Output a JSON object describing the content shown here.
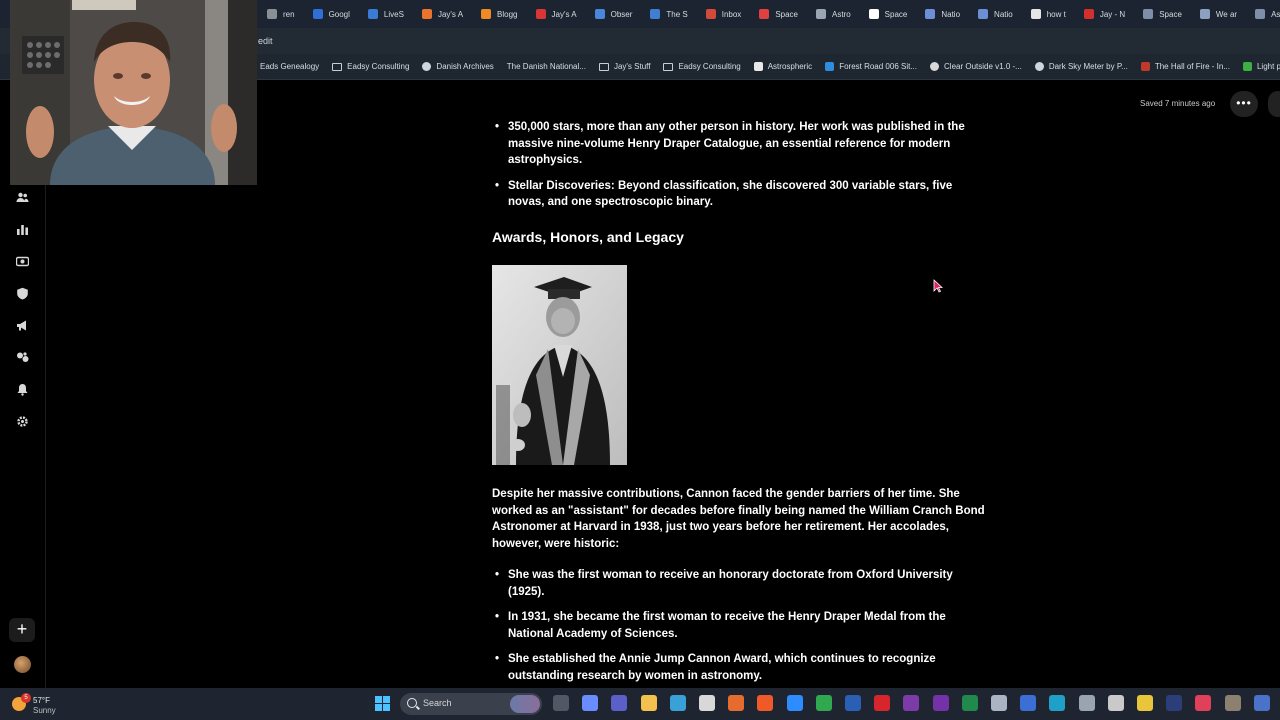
{
  "browser": {
    "tabs": [
      {
        "label": "ren",
        "color": "#8a8f96"
      },
      {
        "label": "Googl",
        "color": "#2f6fd6"
      },
      {
        "label": "LiveS",
        "color": "#3a7bd5"
      },
      {
        "label": "Jay's A",
        "color": "#e8742e"
      },
      {
        "label": "Blogg",
        "color": "#f08a24"
      },
      {
        "label": "Jay's A",
        "color": "#d93535"
      },
      {
        "label": "Obser",
        "color": "#4a86d9"
      },
      {
        "label": "The S",
        "color": "#3f7fd3"
      },
      {
        "label": "Inbox",
        "color": "#d34a3b"
      },
      {
        "label": "Space",
        "color": "#e04040"
      },
      {
        "label": "Astro",
        "color": "#9aa5b4"
      },
      {
        "label": "Space",
        "color": "#ffffff"
      },
      {
        "label": "Natio",
        "color": "#6d8fd6"
      },
      {
        "label": "Natio",
        "color": "#6d8fd6"
      },
      {
        "label": "how t",
        "color": "#e6e6e6"
      },
      {
        "label": "Jay - N",
        "color": "#d32f2f"
      },
      {
        "label": "Space",
        "color": "#7f8fa8"
      },
      {
        "label": "We ar",
        "color": "#8da0c0"
      },
      {
        "label": "Astro",
        "color": "#7f8fa8"
      }
    ],
    "toolbar_text": "edit",
    "bookmarks": [
      {
        "label": "Eads Genealogy",
        "type": "none"
      },
      {
        "label": "Eadsy Consulting",
        "type": "folder"
      },
      {
        "label": "Danish Archives",
        "type": "globe"
      },
      {
        "label": "The Danish National...",
        "type": "none"
      },
      {
        "label": "Jay's Stuff",
        "type": "folder"
      },
      {
        "label": "Eadsy Consulting",
        "type": "folder"
      },
      {
        "label": "Astrospheric",
        "type": "star"
      },
      {
        "label": "Forest Road 006 Sit...",
        "type": "blue"
      },
      {
        "label": "Clear Outside v1.0 -...",
        "type": "moon"
      },
      {
        "label": "Dark Sky Meter by P...",
        "type": "globe"
      },
      {
        "label": "The Hall of Fire - In...",
        "type": "book"
      },
      {
        "label": "Light pol",
        "type": "green"
      }
    ]
  },
  "editor": {
    "saved_status": "Saved 7 minutes ago",
    "more_label": "•••",
    "new_label": "+"
  },
  "document": {
    "cut_bullets": [
      {
        "text": "350,000 stars, more than any other person in history. Her work was published in the massive nine-volume Henry Draper Catalogue, an essential reference for modern astrophysics."
      },
      {
        "text": "Stellar Discoveries: Beyond classification, she discovered 300 variable stars, five novas, and one spectroscopic binary."
      }
    ],
    "heading": "Awards, Honors, and Legacy",
    "paragraph": "Despite her massive contributions, Cannon faced the gender barriers of her time. She worked as an \"assistant\" for decades before finally being named the William Cranch Bond Astronomer at Harvard in 1938, just two years before her retirement. Her accolades, however, were historic:",
    "honors": [
      "She was the first woman to receive an honorary doctorate from Oxford University (1925).",
      "In 1931, she became the first woman to receive the Henry Draper Medal from the National Academy of Sciences.",
      "She established the Annie Jump Cannon Award, which continues to recognize outstanding research by women in astronomy."
    ]
  },
  "taskbar": {
    "weather_temp": "57°F",
    "weather_condition": "Sunny",
    "weather_badge": "5",
    "search_label": "Search",
    "apps": [
      {
        "name": "file-manager",
        "color": "#505866"
      },
      {
        "name": "copilot",
        "color": "#6a8cff"
      },
      {
        "name": "teams",
        "color": "#5b5fc7"
      },
      {
        "name": "file-explorer",
        "color": "#f2c14e"
      },
      {
        "name": "photos",
        "color": "#3aa0d8"
      },
      {
        "name": "itunes",
        "color": "#d8d8d8"
      },
      {
        "name": "firefox",
        "color": "#e66b2e"
      },
      {
        "name": "brave",
        "color": "#f05a28"
      },
      {
        "name": "zoom",
        "color": "#2d8cff"
      },
      {
        "name": "chrome",
        "color": "#2fa84f"
      },
      {
        "name": "word",
        "color": "#2b5fb4"
      },
      {
        "name": "acrobat",
        "color": "#d7262b"
      },
      {
        "name": "onenote",
        "color": "#7d3ba8"
      },
      {
        "name": "onenote-2",
        "color": "#7332a7"
      },
      {
        "name": "excel",
        "color": "#1f8a4c"
      },
      {
        "name": "app-bird",
        "color": "#aab4c2"
      },
      {
        "name": "app-blue",
        "color": "#3b6fd6"
      },
      {
        "name": "edge",
        "color": "#1fa0c9"
      },
      {
        "name": "stellarium",
        "color": "#9aa4b0"
      },
      {
        "name": "sz-app",
        "color": "#c9c9c9"
      },
      {
        "name": "pen-app",
        "color": "#e8c53a"
      },
      {
        "name": "visual-studio",
        "color": "#2c3e7a"
      },
      {
        "name": "music",
        "color": "#e0405a"
      },
      {
        "name": "gimp",
        "color": "#8c8070"
      },
      {
        "name": "app-monitor",
        "color": "#4a72c9"
      }
    ]
  }
}
